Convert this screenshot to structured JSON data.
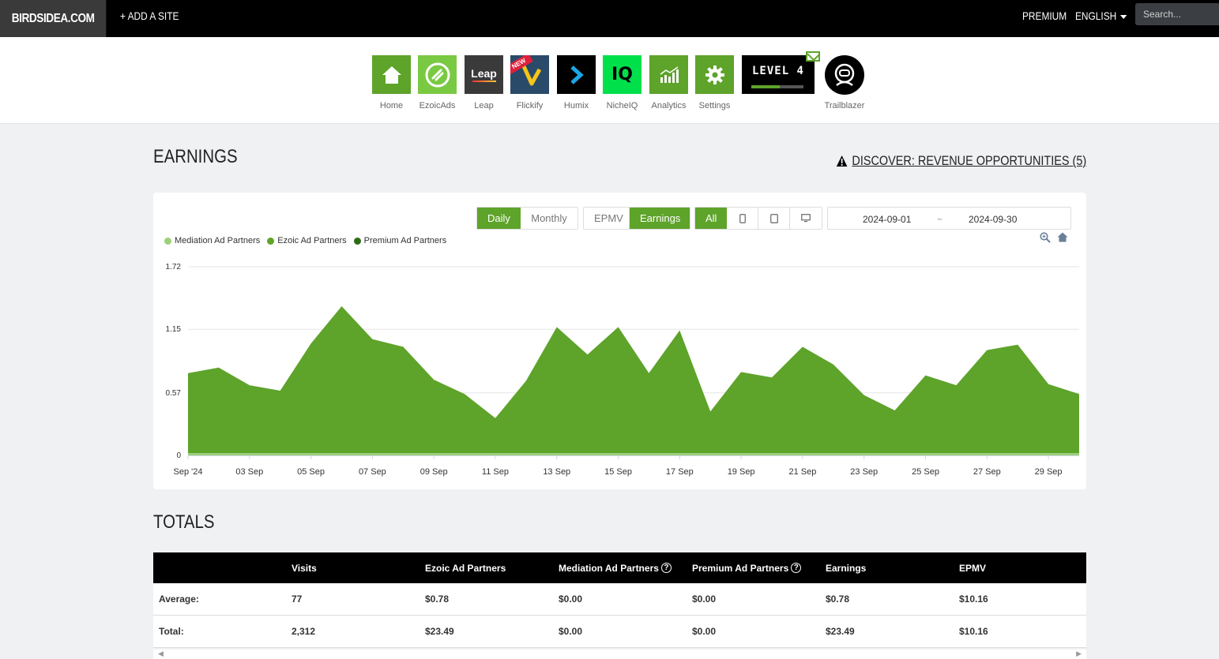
{
  "topbar": {
    "brand": "BIRDSIDEA.COM",
    "add_site": "+ ADD A SITE",
    "premium": "PREMIUM",
    "language": "ENGLISH",
    "search_placeholder": "Search..."
  },
  "apps": [
    {
      "label": "Home",
      "icon": "home-icon",
      "color": "#5ea32a"
    },
    {
      "label": "EzoicAds",
      "icon": "ezoicads-icon",
      "color": "#7ac943"
    },
    {
      "label": "Leap",
      "icon": "leap-icon",
      "color": "#3a3a3a",
      "text": "Leap"
    },
    {
      "label": "Flickify",
      "icon": "flickify-icon",
      "color": "#2a4a6a",
      "badge": "NEW"
    },
    {
      "label": "Humix",
      "icon": "humix-icon",
      "color": "#000000"
    },
    {
      "label": "NicheIQ",
      "icon": "nicheiq-icon",
      "color": "#00e04b",
      "text": "IQ"
    },
    {
      "label": "Analytics",
      "icon": "analytics-icon",
      "color": "#5ea32a"
    },
    {
      "label": "Settings",
      "icon": "gear-icon",
      "color": "#5ea32a"
    }
  ],
  "level": {
    "text": "LEVEL 4",
    "progress": 0.55
  },
  "trailblazer": {
    "label": "Trailblazer"
  },
  "earnings": {
    "title": "EARNINGS",
    "discover": "DISCOVER: REVENUE OPPORTUNITIES (5)"
  },
  "controls": {
    "period": [
      {
        "label": "Daily",
        "active": true
      },
      {
        "label": "Monthly",
        "active": false
      }
    ],
    "metric": [
      {
        "label": "EPMV",
        "active": false
      },
      {
        "label": "Earnings",
        "active": true
      }
    ],
    "device": [
      {
        "label": "All",
        "active": true
      }
    ],
    "date_start": "2024-09-01",
    "date_sep": "~",
    "date_end": "2024-09-30"
  },
  "colors": {
    "accent": "#5ea32a",
    "mediation": "#9ccf7a",
    "ezoic": "#5ea32a",
    "premium": "#2e6b16"
  },
  "chart_data": {
    "type": "area",
    "legend": [
      {
        "name": "Mediation Ad Partners",
        "color": "#9ccf7a"
      },
      {
        "name": "Ezoic Ad Partners",
        "color": "#5ea32a"
      },
      {
        "name": "Premium Ad Partners",
        "color": "#2e6b16"
      }
    ],
    "y_ticks": [
      "0",
      "0.57",
      "1.15",
      "1.72"
    ],
    "ylim": [
      0,
      1.72
    ],
    "x_tick_labels": [
      "Sep '24",
      "03 Sep",
      "05 Sep",
      "07 Sep",
      "09 Sep",
      "11 Sep",
      "13 Sep",
      "15 Sep",
      "17 Sep",
      "19 Sep",
      "21 Sep",
      "23 Sep",
      "25 Sep",
      "27 Sep",
      "29 Sep"
    ],
    "x": [
      "2024-09-01",
      "2024-09-02",
      "2024-09-03",
      "2024-09-04",
      "2024-09-05",
      "2024-09-06",
      "2024-09-07",
      "2024-09-08",
      "2024-09-09",
      "2024-09-10",
      "2024-09-11",
      "2024-09-12",
      "2024-09-13",
      "2024-09-14",
      "2024-09-15",
      "2024-09-16",
      "2024-09-17",
      "2024-09-18",
      "2024-09-19",
      "2024-09-20",
      "2024-09-21",
      "2024-09-22",
      "2024-09-23",
      "2024-09-24",
      "2024-09-25",
      "2024-09-26",
      "2024-09-27",
      "2024-09-28",
      "2024-09-29",
      "2024-09-30"
    ],
    "series": [
      {
        "name": "Ezoic Ad Partners",
        "values": [
          0.75,
          0.8,
          0.64,
          0.59,
          1.02,
          1.36,
          1.06,
          0.99,
          0.69,
          0.56,
          0.34,
          0.68,
          1.17,
          0.92,
          1.17,
          0.75,
          1.14,
          0.4,
          0.76,
          0.71,
          0.99,
          0.83,
          0.55,
          0.41,
          0.73,
          0.64,
          0.96,
          1.01,
          0.65,
          0.56
        ]
      },
      {
        "name": "Mediation Ad Partners",
        "values": [
          0,
          0,
          0,
          0,
          0,
          0,
          0,
          0,
          0,
          0,
          0,
          0,
          0,
          0,
          0,
          0,
          0,
          0,
          0,
          0,
          0,
          0,
          0,
          0,
          0,
          0,
          0,
          0,
          0,
          0
        ]
      },
      {
        "name": "Premium Ad Partners",
        "values": [
          0,
          0,
          0,
          0,
          0,
          0,
          0,
          0,
          0,
          0,
          0,
          0,
          0,
          0,
          0,
          0,
          0,
          0,
          0,
          0,
          0,
          0,
          0,
          0,
          0,
          0,
          0,
          0,
          0,
          0
        ]
      }
    ]
  },
  "totals": {
    "title": "TOTALS",
    "headers": [
      "",
      "Visits",
      "Ezoic Ad Partners",
      "Mediation Ad Partners",
      "Premium Ad Partners",
      "Earnings",
      "EPMV"
    ],
    "rows": [
      {
        "label": "Average:",
        "cells": [
          "77",
          "$0.78",
          "$0.00",
          "$0.00",
          "$0.78",
          "$10.16"
        ]
      },
      {
        "label": "Total:",
        "cells": [
          "2,312",
          "$23.49",
          "$0.00",
          "$0.00",
          "$23.49",
          "$10.16"
        ]
      }
    ]
  }
}
